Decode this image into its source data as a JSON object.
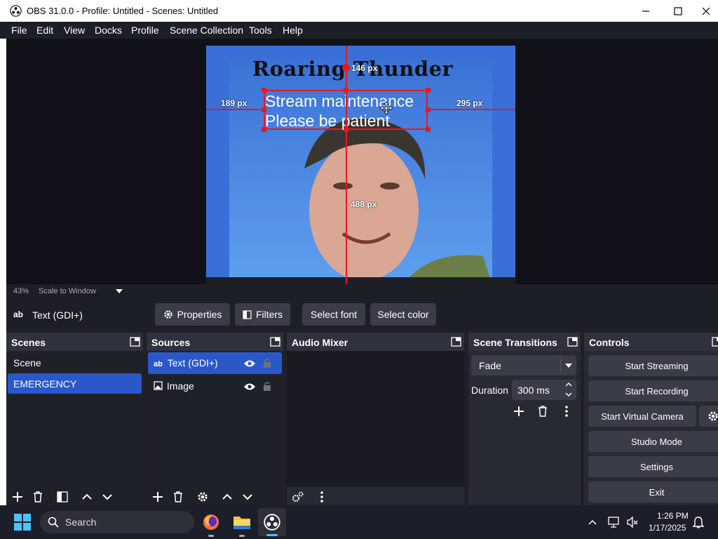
{
  "window": {
    "title": "OBS 31.0.0 - Profile: Untitled - Scenes: Untitled"
  },
  "menu": [
    "File",
    "Edit",
    "View",
    "Docks",
    "Profile",
    "Scene Collection",
    "Tools",
    "Help"
  ],
  "preview": {
    "headline": "Roaring Thunder",
    "text_line1": "Stream maintenance",
    "text_line2": "Please be patient",
    "measure_top": "146 px",
    "measure_left": "189 px",
    "measure_right": "295 px",
    "measure_bottom": "488 px"
  },
  "scale": {
    "zoom": "43%",
    "mode": "Scale to Window"
  },
  "toolbar": {
    "source_label": "Text (GDI+)",
    "properties": "Properties",
    "filters": "Filters",
    "select_font": "Select font",
    "select_color": "Select color"
  },
  "scenes": {
    "title": "Scenes",
    "items": [
      "Scene",
      "EMERGENCY"
    ]
  },
  "sources": {
    "title": "Sources",
    "items": [
      "Text (GDI+)",
      "Image"
    ]
  },
  "mixer": {
    "title": "Audio Mixer"
  },
  "transitions": {
    "title": "Scene Transitions",
    "type": "Fade",
    "duration_label": "Duration",
    "duration_value": "300 ms"
  },
  "controls": {
    "title": "Controls",
    "start_streaming": "Start Streaming",
    "start_recording": "Start Recording",
    "start_virtual_camera": "Start Virtual Camera",
    "studio_mode": "Studio Mode",
    "settings": "Settings",
    "exit": "Exit"
  },
  "taskbar": {
    "search": "Search",
    "time": "1:26 PM",
    "date": "1/17/2025"
  }
}
